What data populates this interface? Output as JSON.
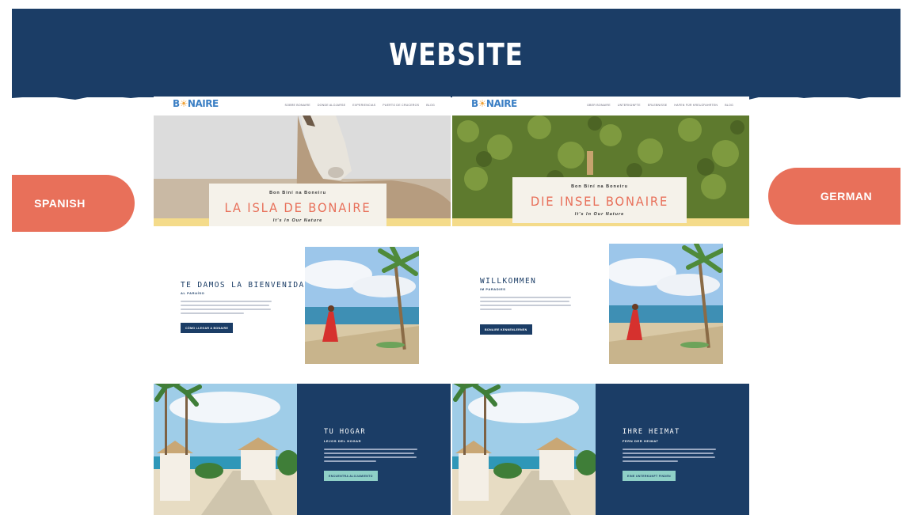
{
  "banner": {
    "title": "WEBSITE"
  },
  "labels": {
    "left": "SPANISH",
    "right": "GERMAN"
  },
  "spanish": {
    "logo": "BONAIRE",
    "nav": [
      "SOBRE BONAIRE",
      "DONDE ALOJARSE",
      "EXPERIENCIAS",
      "PUERTO DE CRUCEROS",
      "BLOG"
    ],
    "hero_pre": "Bon Biní na Boneiru",
    "hero_title": "LA ISLA DE BONAIRE",
    "hero_sub": "It's In Our Nature",
    "welcome_title": "TE DAMOS LA BIENVENIDA",
    "welcome_sub": "AL PARAÍSO",
    "welcome_button": "CÓMO LLEGAR A BONAIRE",
    "home_title": "TU HOGAR",
    "home_sub": "LEJOS DEL HOGAR",
    "home_button": "ENCUENTRA ALOJAMIENTO"
  },
  "german": {
    "logo": "BONAIRE",
    "nav": [
      "ÜBER BONAIRE",
      "UNTERKÜNFTE",
      "ERLEBNISSE",
      "HAFEN FÜR KREUZFAHRTEN",
      "BLOG"
    ],
    "hero_pre": "Bon Biní na Boneiru",
    "hero_title": "DIE INSEL BONAIRE",
    "hero_sub": "It's In Our Nature",
    "welcome_title": "WILLKOMMEN",
    "welcome_sub": "IM PARADIES",
    "welcome_button": "BONAIRE KENNENLERNEN",
    "home_title": "IHRE HEIMAT",
    "home_sub": "FERN DER HEIMAT",
    "home_button": "EINE UNTERKUNFT FINDEN"
  },
  "colors": {
    "navy": "#1b3d66",
    "coral": "#e8705a",
    "sand": "#f4db8a",
    "mint": "#8fd0c7"
  }
}
